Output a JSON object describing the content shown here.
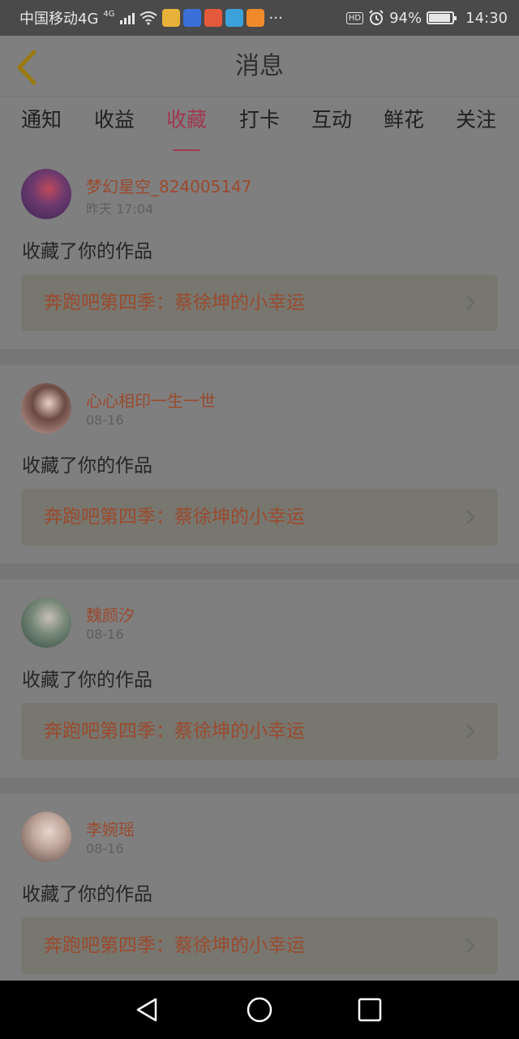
{
  "status_bar": {
    "carrier": "中国移动4G",
    "network_badge": "4G",
    "app_icons": [
      {
        "name": "notification-app-icon",
        "color": "#e8b23a"
      },
      {
        "name": "baidu-icon",
        "color": "#3b6fd8"
      },
      {
        "name": "news-app-icon",
        "color": "#e45a3b"
      },
      {
        "name": "browser-app-icon",
        "color": "#3aa2d8"
      },
      {
        "name": "uc-browser-icon",
        "color": "#f08a2a"
      }
    ],
    "more": "···",
    "hd": "HD",
    "battery": "94%",
    "battery_level": 0.94,
    "time": "14:30"
  },
  "header": {
    "title": "消息",
    "back_icon": "chevron-left-icon",
    "back_color": "#9a7a10"
  },
  "tabs": [
    {
      "label": "通知",
      "active": false
    },
    {
      "label": "收益",
      "active": false
    },
    {
      "label": "收藏",
      "active": true
    },
    {
      "label": "打卡",
      "active": false
    },
    {
      "label": "互动",
      "active": false
    },
    {
      "label": "鲜花",
      "active": false
    },
    {
      "label": "关注",
      "active": false
    }
  ],
  "messages": [
    {
      "user": "梦幻星空_824005147",
      "time": "昨天 17:04",
      "action": "收藏了你的作品",
      "work": "奔跑吧第四季：蔡徐坤的小幸运",
      "avatar_colors": [
        "#3a2552",
        "#6d3a6e",
        "#c04a5a"
      ]
    },
    {
      "user": "心心相印一生一世",
      "time": "08-16",
      "action": "收藏了你的作品",
      "work": "奔跑吧第四季：蔡徐坤的小幸运",
      "avatar_colors": [
        "#caa6a0",
        "#6b4a44",
        "#e8d0c8"
      ]
    },
    {
      "user": "魏颜汐",
      "time": "08-16",
      "action": "收藏了你的作品",
      "work": "奔跑吧第四季：蔡徐坤的小幸运",
      "avatar_colors": [
        "#2f4a3e",
        "#7a8a7a",
        "#c8c0b8"
      ]
    },
    {
      "user": "李婉瑶",
      "time": "08-16",
      "action": "收藏了你的作品",
      "work": "奔跑吧第四季：蔡徐坤的小幸运",
      "avatar_colors": [
        "#5c4a44",
        "#bfa59a",
        "#e6d6ce"
      ]
    }
  ],
  "colors": {
    "accent": "#a0384e",
    "link": "#9b4a2e",
    "overlay_bg": "#7f7f7f"
  }
}
